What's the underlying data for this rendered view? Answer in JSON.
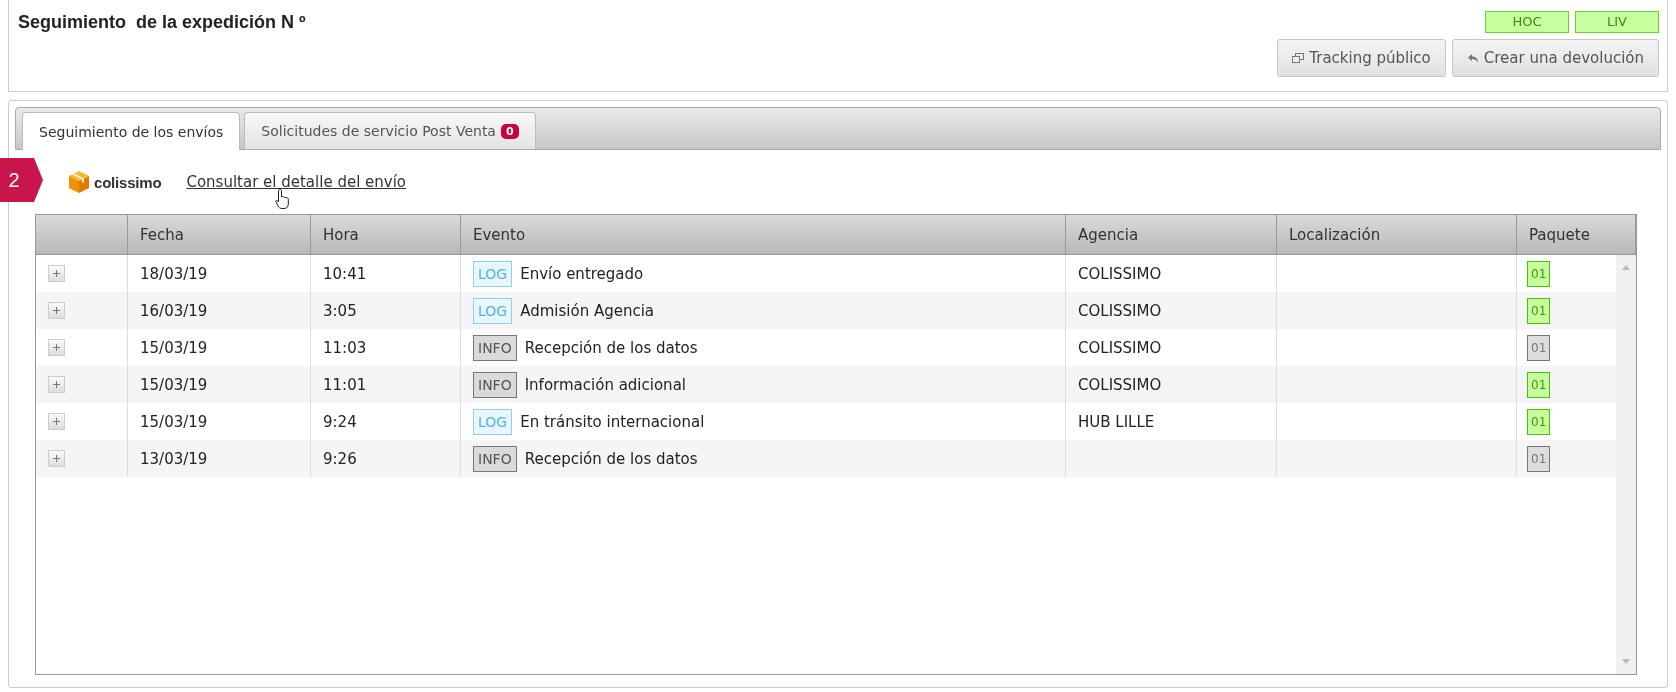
{
  "header": {
    "title": "Seguimiento  de la expedición N º",
    "status_tags": [
      "HOC",
      "LIV"
    ],
    "buttons": [
      {
        "kind": "tracking",
        "label": "Tracking público"
      },
      {
        "kind": "return",
        "label": "Crear una devolución"
      }
    ]
  },
  "tabs": [
    {
      "label": "Seguimiento de los envíos",
      "selected": true
    },
    {
      "label": "Solicitudes de servicio Post Venta",
      "selected": false,
      "badge": "0"
    }
  ],
  "step_marker": "2",
  "carrier": {
    "name": "colissimo",
    "link": "Consultar el detalle del envío"
  },
  "table": {
    "columns": [
      "",
      "Fecha",
      "Hora",
      "Evento",
      "Agencia",
      "Localización",
      "Paquete"
    ],
    "rows": [
      {
        "date": "18/03/19",
        "time": "10:41",
        "kind": "log",
        "event_tag": "LOG",
        "event": "Envío entregado",
        "agency": "COLISSIMO",
        "package": "01",
        "package_active": true
      },
      {
        "date": "16/03/19",
        "time": "3:05",
        "kind": "log",
        "event_tag": "LOG",
        "event": "Admisión Agencia",
        "agency": "COLISSIMO",
        "package": "01",
        "package_active": true
      },
      {
        "date": "15/03/19",
        "time": "11:03",
        "kind": "info",
        "event_tag": "INFO",
        "event": "Recepción de los datos",
        "agency": "COLISSIMO",
        "package": "01",
        "package_active": false
      },
      {
        "date": "15/03/19",
        "time": "11:01",
        "kind": "info",
        "event_tag": "INFO",
        "event": "Información adicional",
        "agency": "COLISSIMO",
        "package": "01",
        "package_active": true
      },
      {
        "date": "15/03/19",
        "time": "9:24",
        "kind": "log",
        "event_tag": "LOG",
        "event": "En tránsito internacional",
        "agency": "HUB LILLE",
        "package": "01",
        "package_active": true
      },
      {
        "date": "13/03/19",
        "time": "9:26",
        "kind": "info",
        "event_tag": "INFO",
        "event": "Recepción de los datos",
        "agency": "",
        "package": "01",
        "package_active": false
      }
    ]
  }
}
